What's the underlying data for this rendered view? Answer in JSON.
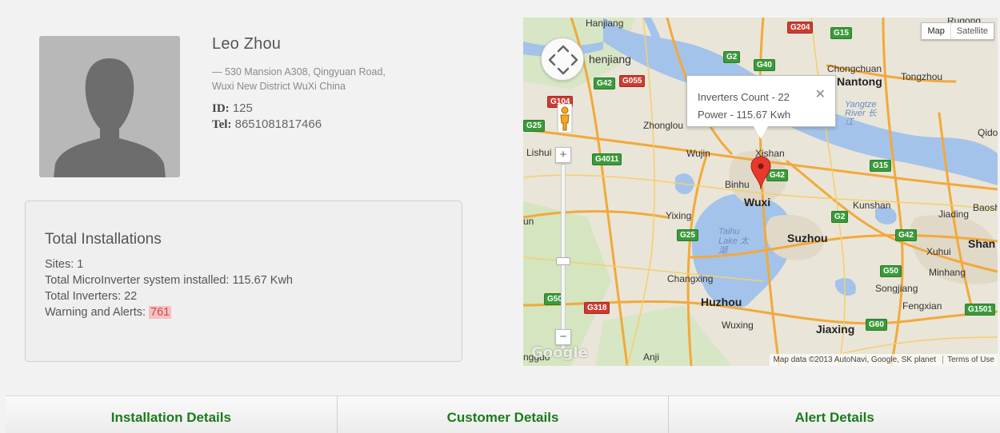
{
  "customer": {
    "name": "Leo Zhou",
    "address": "— 530 Mansion A308, Qingyuan Road, Wuxi New District WuXi China",
    "id_label": "ID",
    "id_value": "125",
    "tel_label": "Tel",
    "tel_value": "8651081817466"
  },
  "installations": {
    "title": "Total Installations",
    "sites": "Sites: 1",
    "system": "Total MicroInverter system installed: 115.67 Kwh",
    "inverters": "Total Inverters: 22",
    "warnings_label": "Warning and Alerts: ",
    "warnings_count": "761"
  },
  "map": {
    "type_map": "Map",
    "type_satellite": "Satellite",
    "info_inverters": "Inverters Count - 22",
    "info_power": "Power - 115.67 Kwh",
    "info_close": "✕",
    "zoom_in": "+",
    "zoom_out": "−",
    "google": "Google",
    "attribution": "Map data ©2013 AutoNavi, Google, SK planet",
    "terms": "Terms of Use",
    "labels": {
      "hanjiang": "Hanjiang",
      "henjiang": "henjiang",
      "rugong": "Rugong",
      "chongchuan": "Chongchuan",
      "nantong": "Nantong",
      "tongzhou": "Tongzhou",
      "yangtze": "Yangtze River 长江",
      "qidong": "Qidor",
      "zhonglou": "Zhonglou",
      "lishui": "Lishui",
      "wujin": "Wujin",
      "xishan": "Xishan",
      "binhu": "Binhu",
      "wuxi": "Wuxi",
      "yixing": "Yixing",
      "taihu": "Taihu Lake 太湖",
      "suzhou": "Suzhou",
      "kunshan": "Kunshan",
      "jiading": "Jiading",
      "baosha": "Baosha",
      "shanghai": "Shan",
      "xuhui": "Xuhui",
      "minhang": "Minhang",
      "changxing": "Changxing",
      "songjiang": "Songjiang",
      "huzhou": "Huzhou",
      "wuxing": "Wuxing",
      "jiaxing": "Jiaxing",
      "fengxian": "Fengxian",
      "anji": "Anji",
      "un": "un",
      "ngguo": "ngguo"
    }
  },
  "tabs": {
    "installation": "Installation Details",
    "customer": "Customer Details",
    "alert": "Alert Details"
  }
}
